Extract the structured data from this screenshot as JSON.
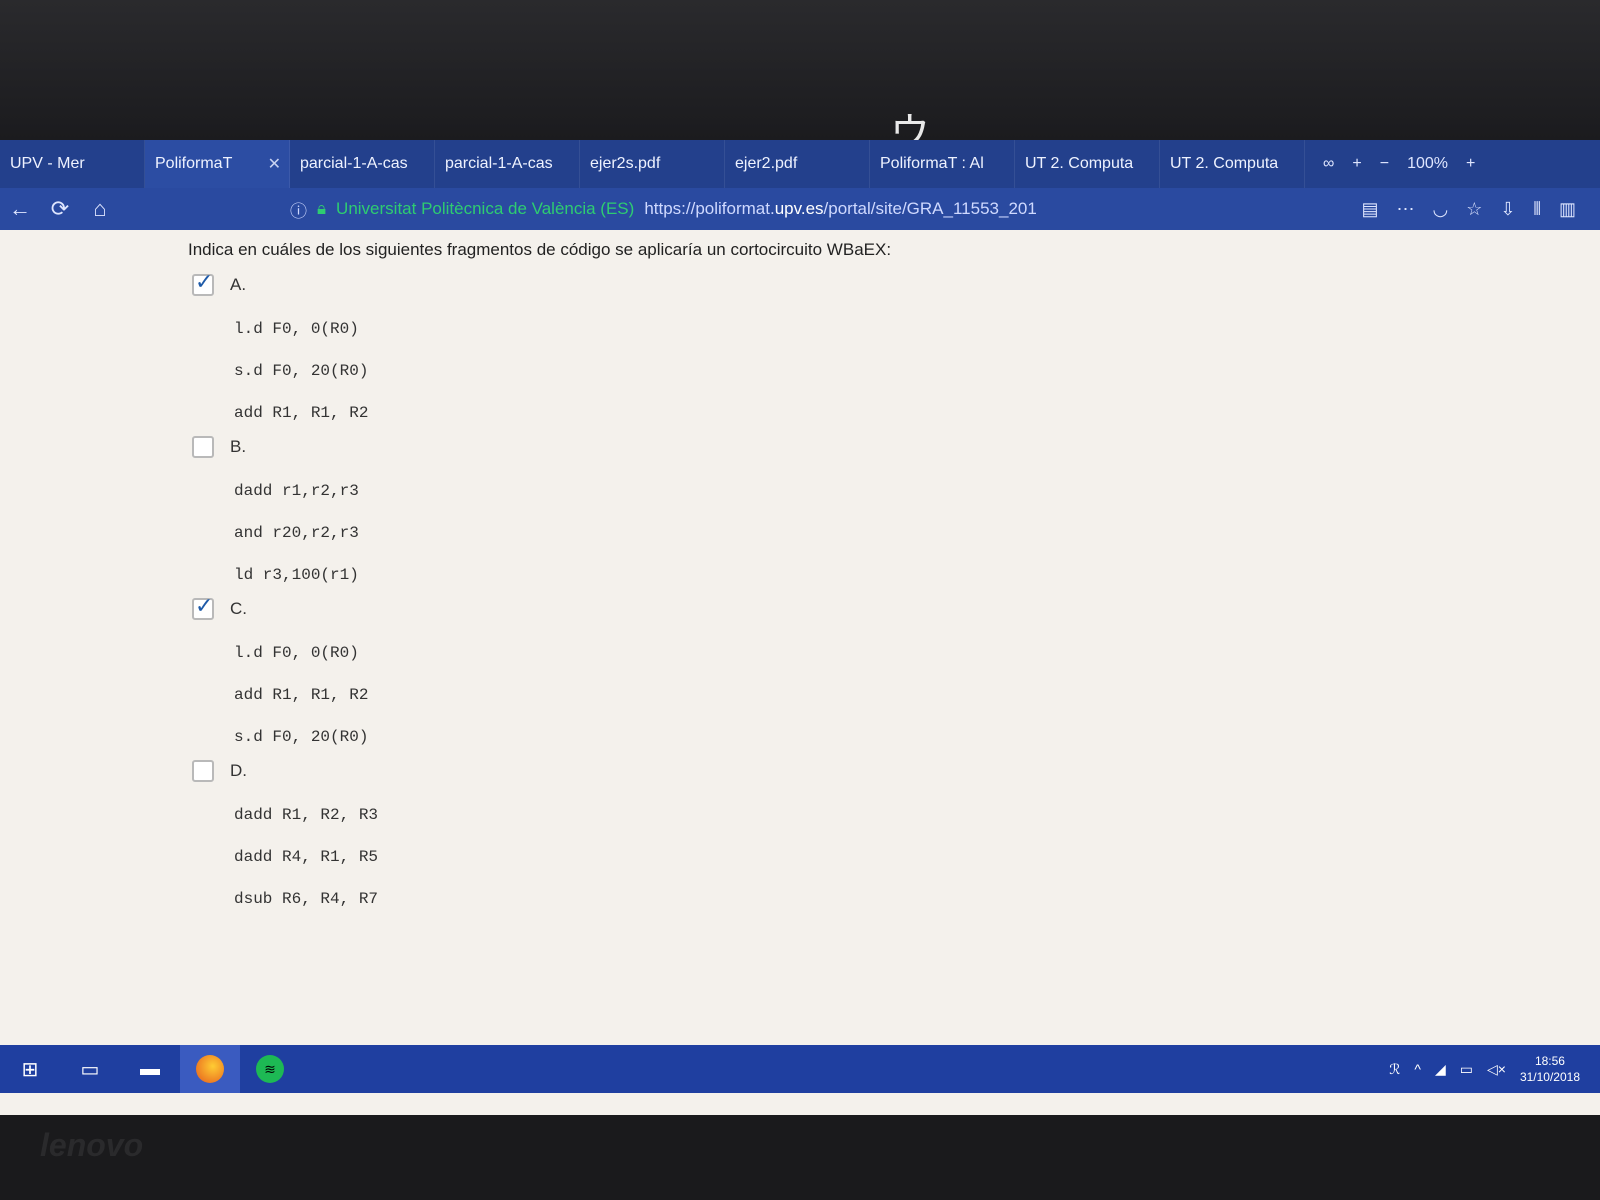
{
  "browser": {
    "tabs": [
      {
        "label": "UPV - Mer"
      },
      {
        "label": "PoliformaT",
        "active": true
      },
      {
        "label": "parcial-1-A-cas"
      },
      {
        "label": "parcial-1-A-cas"
      },
      {
        "label": "ejer2s.pdf"
      },
      {
        "label": "ejer2.pdf"
      },
      {
        "label": "PoliformaT : Al"
      },
      {
        "label": "UT 2. Computa"
      },
      {
        "label": "UT 2. Computa"
      }
    ],
    "zoom": "100%",
    "site_identity": "Universitat Politècnica de València (ES)",
    "url_prefix": "https://poliformat.",
    "url_host": "upv.es",
    "url_path": "/portal/site/GRA_11553_201"
  },
  "question": {
    "prompt": "Indica en cuáles de los siguientes fragmentos de código se aplicaría un cortocircuito WBaEX:",
    "options": [
      {
        "label": "A.",
        "checked": true,
        "code": [
          "l.d F0, 0(R0)",
          "s.d F0, 20(R0)",
          "add R1, R1, R2"
        ]
      },
      {
        "label": "B.",
        "checked": false,
        "code": [
          "dadd r1,r2,r3",
          "and r20,r2,r3",
          "ld r3,100(r1)"
        ]
      },
      {
        "label": "C.",
        "checked": true,
        "code": [
          "l.d F0, 0(R0)",
          "add R1, R1, R2",
          "s.d F0, 20(R0)"
        ]
      },
      {
        "label": "D.",
        "checked": false,
        "code": [
          "dadd R1, R2, R3",
          "dadd R4, R1, R5",
          "dsub R6, R4, R7"
        ]
      }
    ]
  },
  "taskbar": {
    "time": "18:56",
    "date": "31/10/2018"
  },
  "hardware": {
    "brand": "lenovo"
  }
}
